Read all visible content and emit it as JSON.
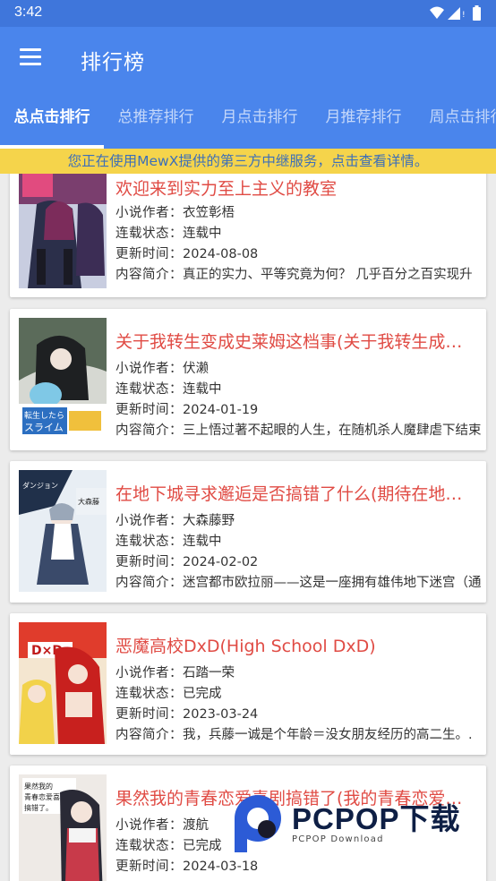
{
  "status_bar": {
    "time": "3:42",
    "icons": [
      "wifi-icon",
      "signal-icon",
      "battery-icon"
    ]
  },
  "app_bar": {
    "title": "排行榜",
    "menu_icon": "menu-icon"
  },
  "tabs": [
    {
      "label": "总点击排行",
      "active": true
    },
    {
      "label": "总推荐排行",
      "active": false
    },
    {
      "label": "月点击排行",
      "active": false
    },
    {
      "label": "月推荐排行",
      "active": false
    },
    {
      "label": "周点击排行",
      "active": false
    }
  ],
  "notice": "您正在使用MewX提供的第三方中继服务，点击查看详情。",
  "labels": {
    "author": "小说作者：",
    "status": "连载状态：",
    "updated": "更新时间：",
    "summary": "内容简介："
  },
  "books": [
    {
      "title": "欢迎来到实力至上主义的教室",
      "author": "衣笠彰梧",
      "status": "连载中",
      "updated": "2024-08-08",
      "summary": "真正的实力、平等究竟为何？ 几乎百分之百实现升"
    },
    {
      "title": "关于我转生变成史莱姆这档事(关于我转生成…",
      "author": "伏濑",
      "status": "连载中",
      "updated": "2024-01-19",
      "summary": "三上悟过著不起眼的人生，在随机杀人魔肆虐下结束"
    },
    {
      "title": "在地下城寻求邂逅是否搞错了什么(期待在地…",
      "author": "大森藤野",
      "status": "连载中",
      "updated": "2024-02-02",
      "summary": "迷宫都市欧拉丽——这是一座拥有雄伟地下迷宫（通"
    },
    {
      "title": "恶魔高校DxD(High School DxD)",
      "author": "石踏一荣",
      "status": "已完成",
      "updated": "2023-03-24",
      "summary": "我，兵藤一诚是个年龄＝没女朋友经历的高二生。."
    },
    {
      "title": "果然我的青春恋爱喜剧搞错了(我的青春恋爱…",
      "author": "渡航",
      "status": "已完成",
      "updated": "2024-03-18",
      "summary": ""
    }
  ],
  "watermark": {
    "text": "PCPOP下载",
    "sub": "PCPOP Download"
  },
  "colors": {
    "status_bar": "#3f76db",
    "app_bar": "#4a85ec",
    "notice_bg": "#f5d44b",
    "notice_text": "#3d6fb8",
    "title_text": "#e04b44"
  }
}
